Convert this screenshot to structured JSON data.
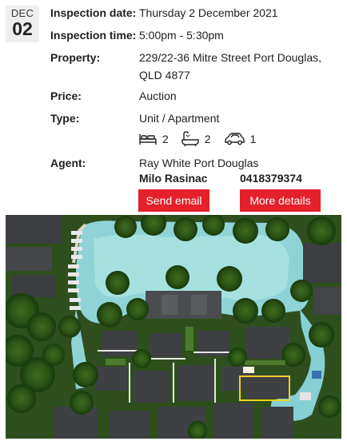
{
  "date_badge": {
    "month": "DEC",
    "day": "02"
  },
  "details": {
    "inspection_date": {
      "label": "Inspection date:",
      "value": "Thursday 2 December 2021"
    },
    "inspection_time": {
      "label": "Inspection time:",
      "value": "5:00pm - 5:30pm"
    },
    "property": {
      "label": "Property:",
      "value": "229/22-36 Mitre Street Port Douglas, QLD 4877"
    },
    "price": {
      "label": "Price:",
      "value": "Auction"
    },
    "type": {
      "label": "Type:",
      "value": "Unit / Apartment"
    }
  },
  "features": [
    {
      "icon": "bed-icon",
      "count": "2"
    },
    {
      "icon": "bath-icon",
      "count": "2"
    },
    {
      "icon": "car-icon",
      "count": "1"
    }
  ],
  "agent": {
    "label": "Agent:",
    "agency": "Ray White Port Douglas",
    "name": "Milo Rasinac",
    "phone": "0418379374"
  },
  "buttons": {
    "send_email": "Send email",
    "more_details": "More details"
  },
  "colors": {
    "accent": "#e4202b",
    "badge_bg": "#eeeeee"
  },
  "image": {
    "description_icon": "aerial-property-photo"
  }
}
